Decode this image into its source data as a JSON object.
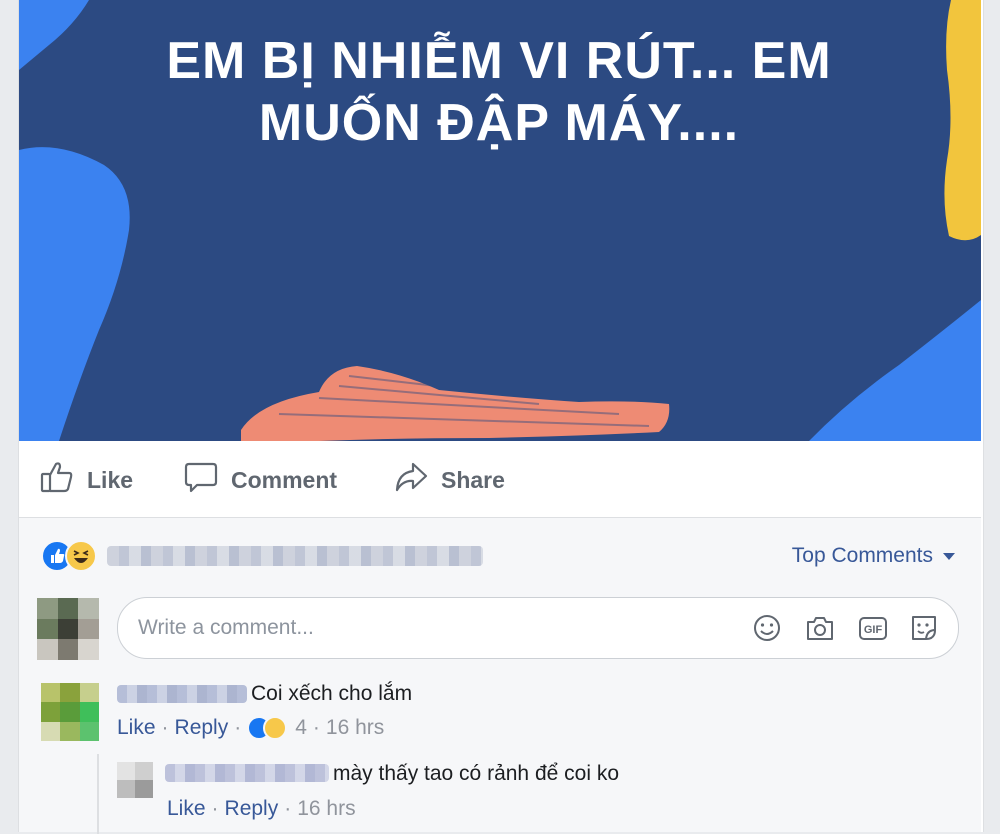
{
  "post": {
    "image_text": "EM BỊ NHIỄM VI RÚT... EM MUỐN ĐẬP MÁY....",
    "background_color": "#2c4a82"
  },
  "actions": {
    "like": "Like",
    "comment": "Comment",
    "share": "Share"
  },
  "comments_header": {
    "sort_label": "Top Comments"
  },
  "composer": {
    "placeholder": "Write a comment..."
  },
  "comments": [
    {
      "text": "Coi xếch cho lắm",
      "like": "Like",
      "reply": "Reply",
      "reaction_count": "4",
      "time": "16 hrs"
    }
  ],
  "replies": [
    {
      "text": "mày thấy tao có rảnh để coi ko",
      "like": "Like",
      "reply": "Reply",
      "time": "16 hrs"
    }
  ],
  "colors": {
    "link": "#385898",
    "muted": "#90949c",
    "like_blue": "#1877f2",
    "haha_yellow": "#f7c84a"
  }
}
